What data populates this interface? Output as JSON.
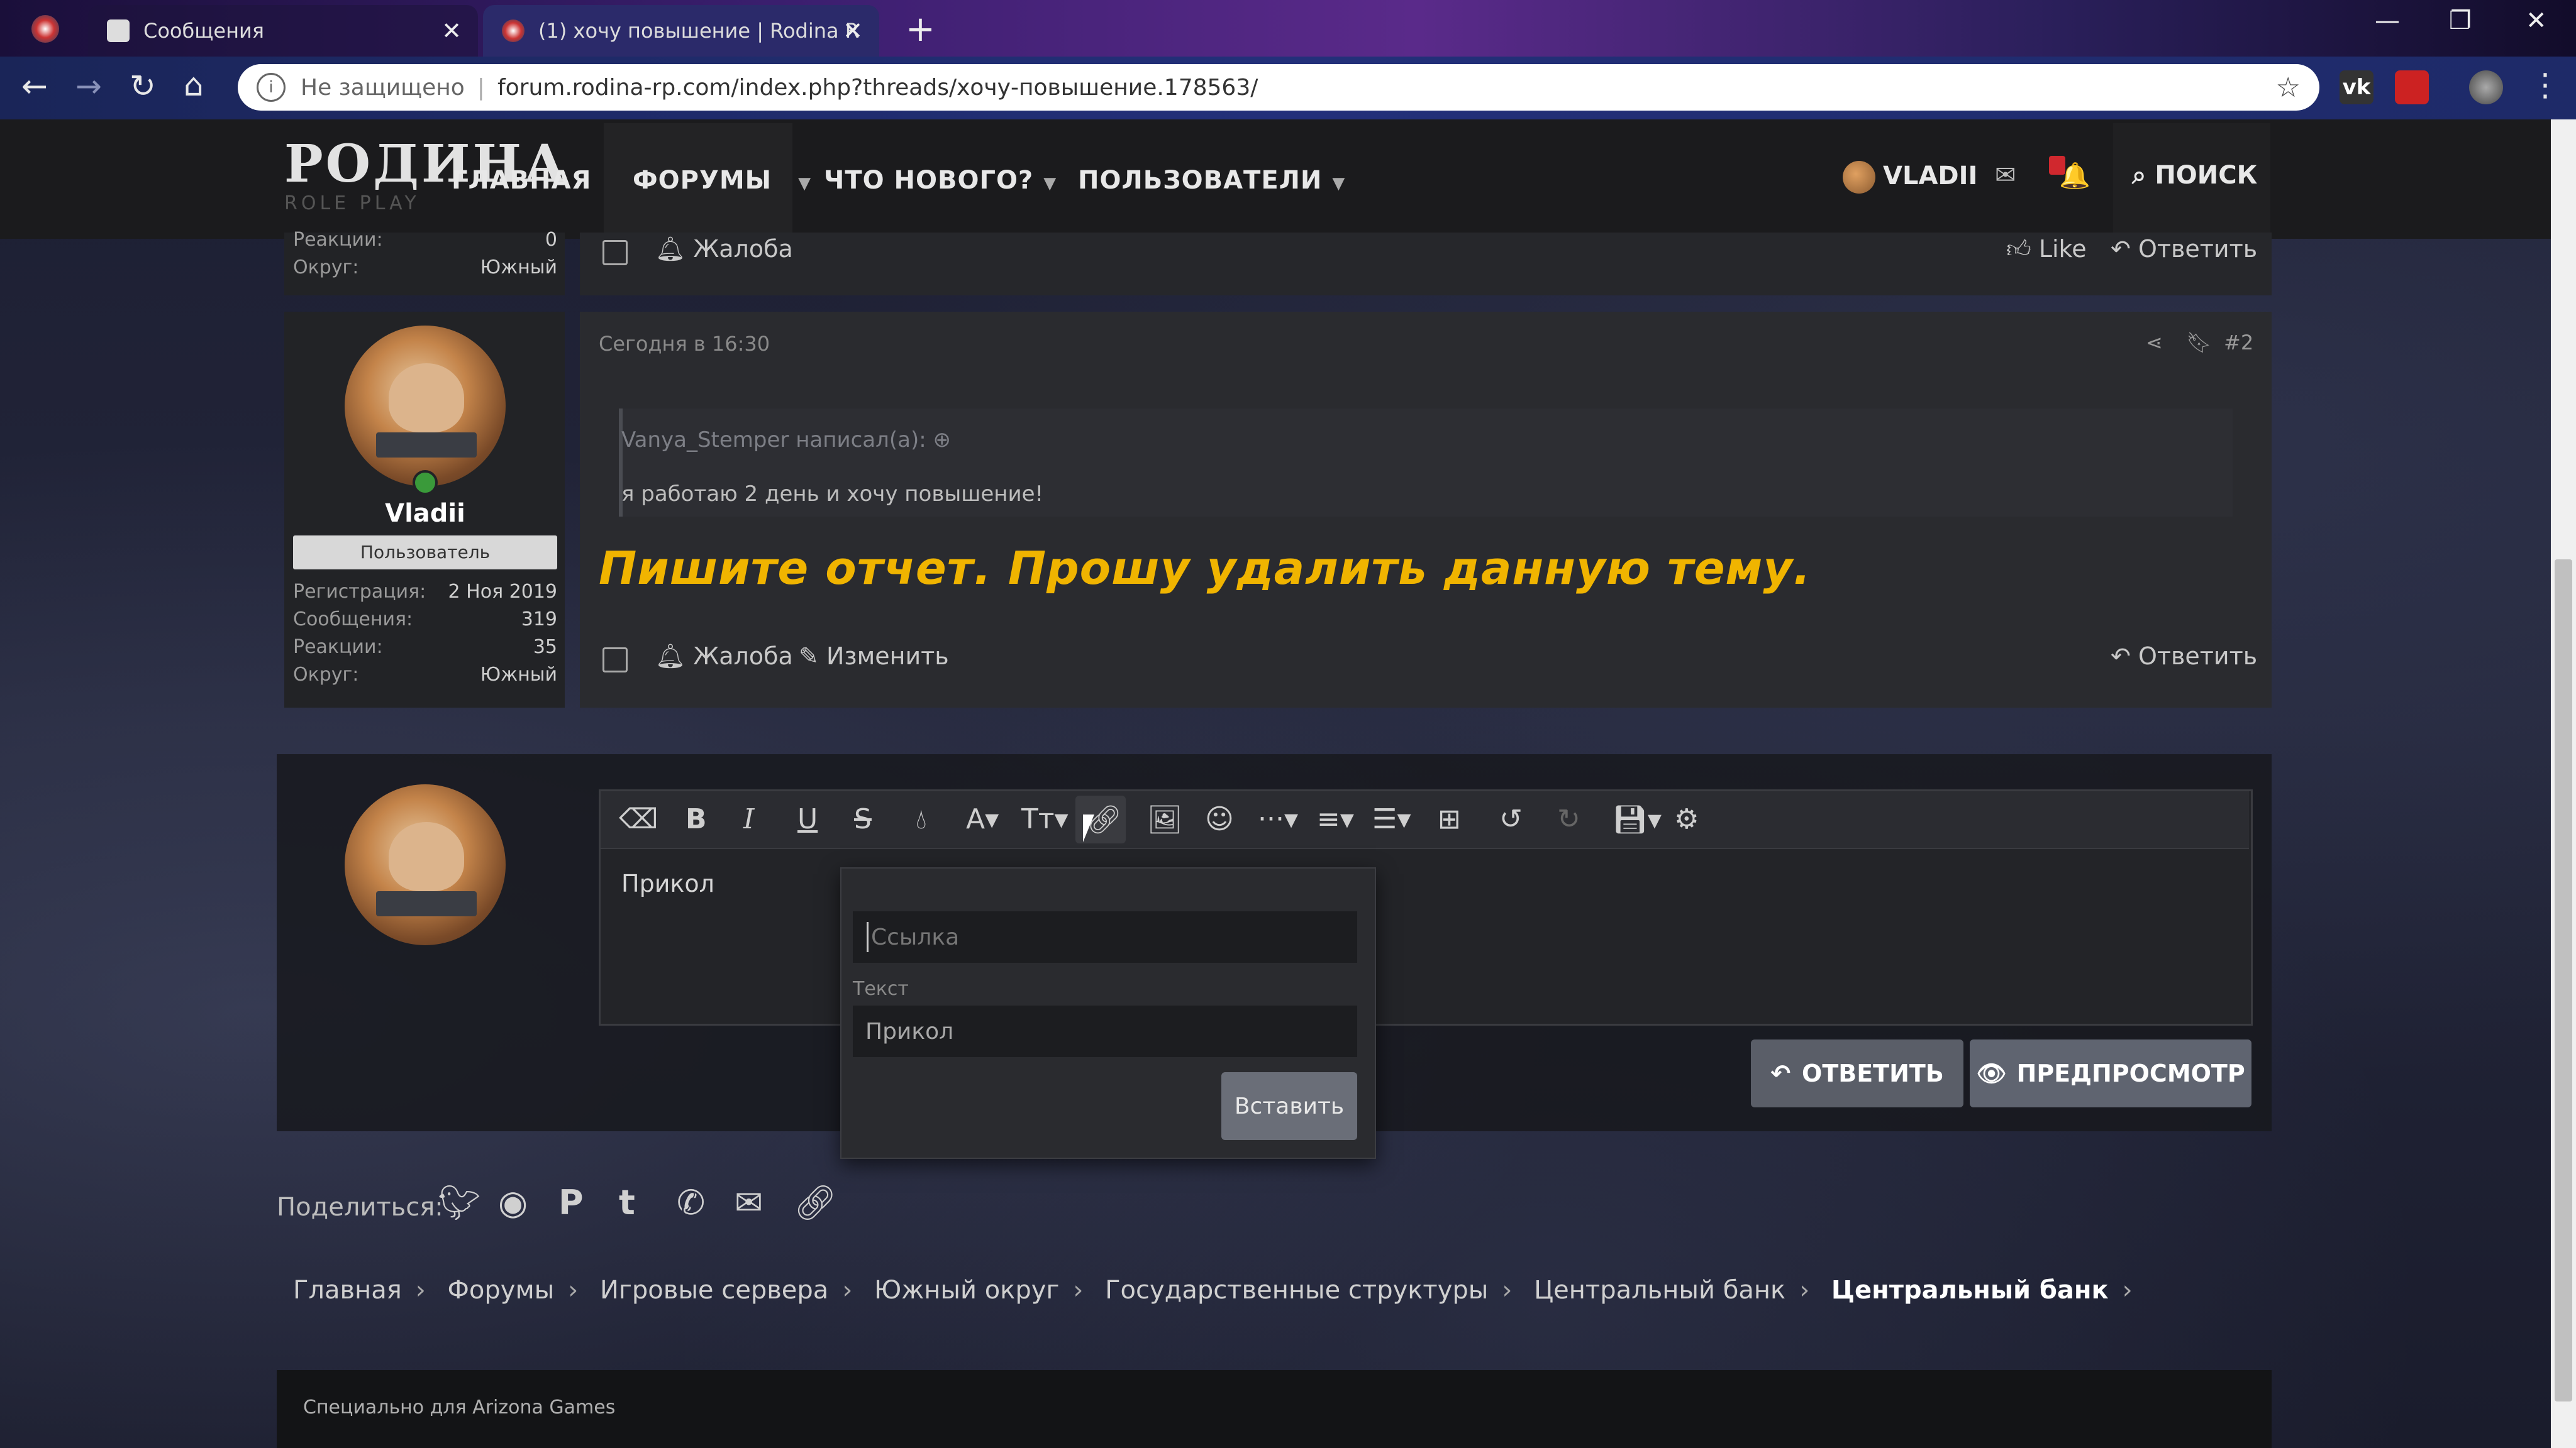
{
  "browser": {
    "tabs": [
      {
        "title": "Сообщения",
        "active": false
      },
      {
        "title": "(1) хочу повышение | Rodina R",
        "active": true
      }
    ],
    "address": {
      "security_label": "Не защищено",
      "url": "forum.rodina-rp.com/index.php?threads/хочу-повышение.178563/"
    },
    "colors": {
      "tabbar": "#3a1e6e",
      "navbar": "#23307a"
    }
  },
  "site": {
    "logo": {
      "line1": "РОДИНА",
      "line2": "ROLE PLAY"
    },
    "nav": [
      {
        "label": "ГЛАВНАЯ"
      },
      {
        "label": "ФОРУМЫ"
      },
      {
        "label": "ЧТО НОВОГО?"
      },
      {
        "label": "ПОЛЬЗОВАТЕЛИ"
      }
    ],
    "user": "VLADII",
    "notifications_badge": "1",
    "search": "ПОИСК"
  },
  "post1_tail": {
    "stats": [
      {
        "label": "Реакции:",
        "value": "0"
      },
      {
        "label": "Округ:",
        "value": "Южный"
      }
    ],
    "actions": {
      "report": "Жалоба",
      "like": "Like",
      "reply": "Ответить"
    }
  },
  "post2": {
    "author": "Vladii",
    "role": "Пользователь",
    "stats": [
      {
        "label": "Регистрация:",
        "value": "2 Ноя 2019"
      },
      {
        "label": "Сообщения:",
        "value": "319"
      },
      {
        "label": "Реакции:",
        "value": "35"
      },
      {
        "label": "Округ:",
        "value": "Южный"
      }
    ],
    "date": "Сегодня в 16:30",
    "number": "#2",
    "quote": {
      "author": "Vanya_Stemper написал(а):",
      "text": "я работаю 2 день и хочу повышение!"
    },
    "message": "Пишите отчет. Прошу удалить данную тему.",
    "message_color": "#f0b400",
    "actions": {
      "report": "Жалоба",
      "edit": "Изменить",
      "reply": "Ответить"
    }
  },
  "editor": {
    "content": "Прикол",
    "link_popup": {
      "url_placeholder": "Ссылка",
      "text_label": "Текст",
      "text_value": "Прикол",
      "insert_button": "Вставить"
    },
    "reply_button": "ОТВЕТИТЬ",
    "preview_button": "ПРЕДПРОСМОТР"
  },
  "share": {
    "label": "Поделиться:"
  },
  "breadcrumbs": [
    "Главная",
    "Форумы",
    "Игровые сервера",
    "Южный округ",
    "Государственные структуры",
    "Центральный банк",
    "Центральный банк"
  ],
  "footer": {
    "text": "Специально для Arizona Games"
  }
}
